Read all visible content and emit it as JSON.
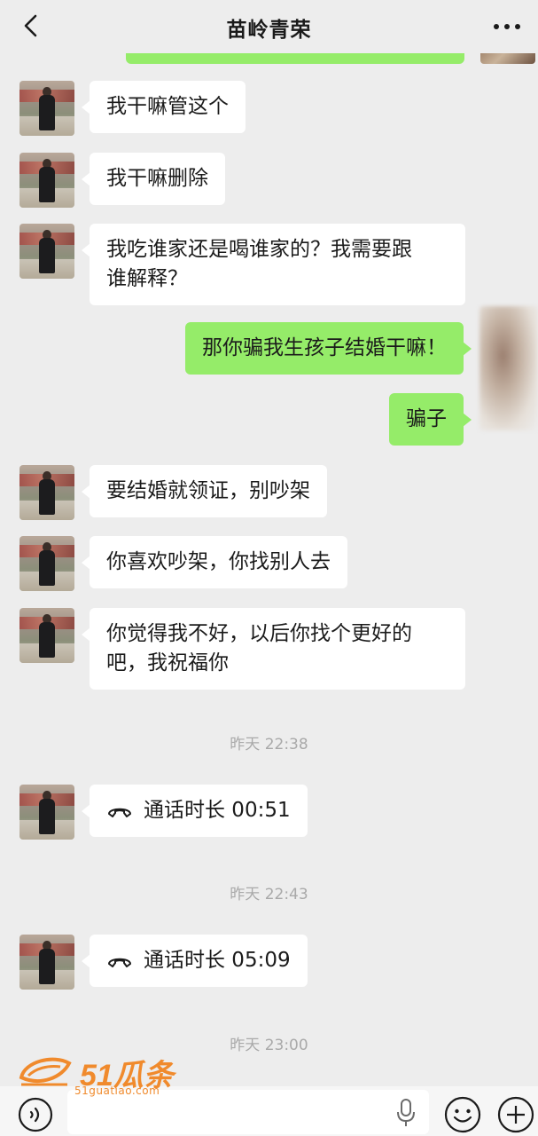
{
  "header": {
    "title": "苗岭青荣",
    "back_icon": "chevron-left-icon",
    "more_icon": "ellipsis-icon"
  },
  "messages": [
    {
      "side": "in",
      "text": "我干嘛管这个"
    },
    {
      "side": "in",
      "text": "我干嘛删除"
    },
    {
      "side": "in",
      "lines": [
        "我吃谁家还是喝谁家的？我需要跟",
        "谁解释？"
      ]
    },
    {
      "side": "out",
      "text": "那你骗我生孩子结婚干嘛！"
    },
    {
      "side": "out",
      "text": "骗子"
    },
    {
      "side": "in",
      "text": "要结婚就领证，别吵架"
    },
    {
      "side": "in",
      "text": "你喜欢吵架，你找别人去"
    },
    {
      "side": "in",
      "lines": [
        "你觉得我不好，以后你找个更好的",
        "吧，我祝福你"
      ]
    }
  ],
  "events": [
    {
      "timestamp": "昨天 22:38",
      "call": "通话时长 00:51"
    },
    {
      "timestamp": "昨天 22:43",
      "call": "通话时长 05:09"
    },
    {
      "timestamp": "昨天 23:00"
    }
  ],
  "watermark": {
    "brand": "51瓜条",
    "url": "51guatiao.com"
  },
  "input_bar": {
    "voice_icon": "voice-mode-icon",
    "mic_icon": "microphone-icon",
    "emoji_icon": "emoji-icon",
    "plus_icon": "plus-circle-icon"
  },
  "colors": {
    "background": "#ededed",
    "sent_bubble": "#95ec69",
    "received_bubble": "#ffffff",
    "watermark": "#f08a2c"
  }
}
